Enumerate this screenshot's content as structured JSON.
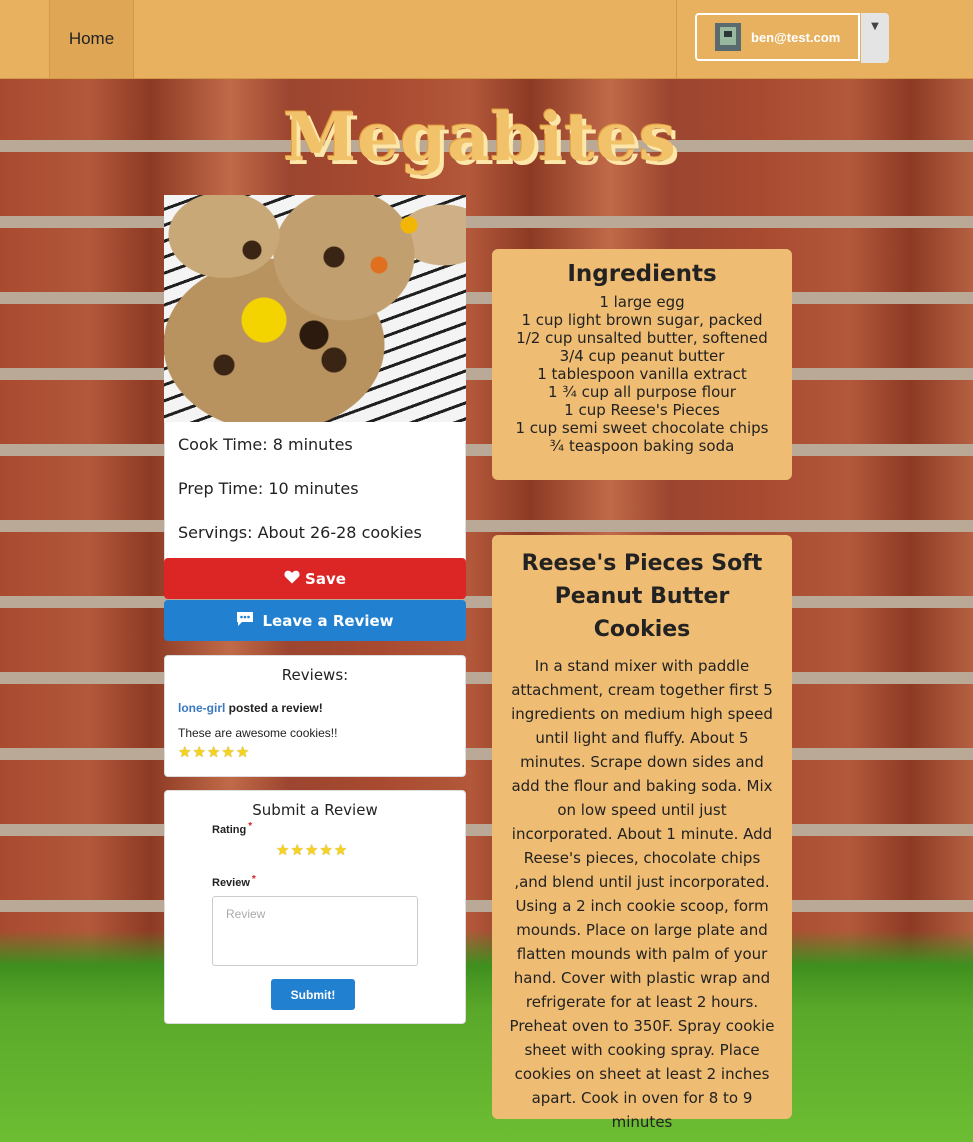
{
  "nav": {
    "home_label": "Home",
    "user_email": "ben@test.com"
  },
  "title": "Megabites",
  "recipe": {
    "cook_time": "Cook Time: 8 minutes",
    "prep_time": "Prep Time: 10 minutes",
    "servings": "Servings: About 26-28 cookies",
    "name": "Reese's Pieces Soft Peanut Butter Cookies",
    "ingredients_heading": "Ingredients",
    "ingredients": [
      "1 large egg",
      "1 cup light brown sugar, packed",
      "1/2 cup unsalted butter, softened",
      "3/4 cup peanut butter",
      "1 tablespoon vanilla extract",
      "1 ¾ cup all purpose flour",
      "1 cup Reese's Pieces",
      "1 cup semi sweet chocolate chips",
      "¾ teaspoon baking soda"
    ],
    "directions": "In a stand mixer with paddle attachment, cream together first 5 ingredients on medium high speed until light and fluffy. About 5 minutes. Scrape down sides and add the flour and baking soda. Mix on low speed until just incorporated. About 1 minute. Add Reese's pieces, chocolate chips ,and blend until just incorporated. Using a 2 inch cookie scoop, form mounds. Place on large plate and flatten mounds with palm of your hand. Cover with plastic wrap and refrigerate for at least 2 hours. Preheat oven to 350F. Spray cookie sheet with cooking spray. Place cookies on sheet at least 2 inches apart. Cook in oven for 8 to 9 minutes"
  },
  "actions": {
    "save_label": "Save",
    "review_label": "Leave a Review"
  },
  "reviews": {
    "heading": "Reviews:",
    "items": [
      {
        "user": "lone-girl",
        "posted": " posted a review!",
        "text": "These are awesome cookies!!",
        "rating": 5
      }
    ]
  },
  "submit_review": {
    "heading": "Submit a Review",
    "rating_label": "Rating",
    "review_label": "Review",
    "review_placeholder": "Review",
    "required_mark": "*",
    "rating_stars": 5,
    "submit_label": "Submit!"
  },
  "colors": {
    "navbar": "#e8b15f",
    "panel": "#efbc73",
    "save_button": "#dc2626",
    "review_button": "#2180d0",
    "star": "#f7d31a"
  }
}
